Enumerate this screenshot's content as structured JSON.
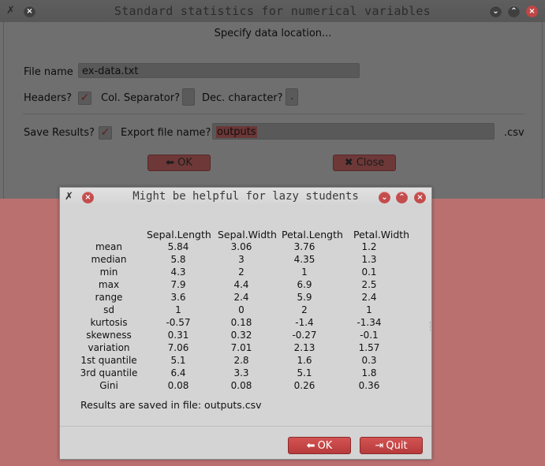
{
  "main_window": {
    "title": "Standard statistics for numerical variables",
    "subtitle": "Specify data location...",
    "file_name_label": "File name",
    "file_name_value": "ex-data.txt",
    "headers_label": "Headers?",
    "col_sep_label": "Col. Separator?",
    "col_sep_value": "",
    "dec_char_label": "Dec. character?",
    "dec_char_value": ".",
    "save_results_label": "Save Results?",
    "export_label": "Export file name?",
    "export_value": "outputs",
    "export_ext": ".csv",
    "ok_label": "OK",
    "close_label": "Close",
    "check_glyph": "✓"
  },
  "dialog": {
    "title": "Might be helpful for lazy students",
    "columns": [
      "Sepal.Length",
      "Sepal.Width",
      "Petal.Length",
      "Petal.Width"
    ],
    "rows": [
      {
        "label": "mean",
        "values": [
          "5.84",
          "3.06",
          "3.76",
          "1.2"
        ]
      },
      {
        "label": "median",
        "values": [
          "5.8",
          "3",
          "4.35",
          "1.3"
        ]
      },
      {
        "label": "min",
        "values": [
          "4.3",
          "2",
          "1",
          "0.1"
        ]
      },
      {
        "label": "max",
        "values": [
          "7.9",
          "4.4",
          "6.9",
          "2.5"
        ]
      },
      {
        "label": "range",
        "values": [
          "3.6",
          "2.4",
          "5.9",
          "2.4"
        ]
      },
      {
        "label": "sd",
        "values": [
          "1",
          "0",
          "2",
          "1"
        ]
      },
      {
        "label": "kurtosis",
        "values": [
          "-0.57",
          "0.18",
          "-1.4",
          "-1.34"
        ]
      },
      {
        "label": "skewness",
        "values": [
          "0.31",
          "0.32",
          "-0.27",
          "-0.1"
        ]
      },
      {
        "label": "variation",
        "values": [
          "7.06",
          "7.01",
          "2.13",
          "1.57"
        ]
      },
      {
        "label": "1st quantile",
        "values": [
          "5.1",
          "2.8",
          "1.6",
          "0.3"
        ]
      },
      {
        "label": "3rd quantile",
        "values": [
          "6.4",
          "3.3",
          "5.1",
          "1.8"
        ]
      },
      {
        "label": "Gini",
        "values": [
          "0.08",
          "0.08",
          "0.26",
          "0.36"
        ]
      }
    ],
    "saved_message": "Results are saved in file: outputs.csv",
    "ok_label": "OK",
    "quit_label": "Quit"
  },
  "colors": {
    "accent_red": "#c44c4c",
    "background_pink": "#bb7070",
    "dialog_bg": "#d4d4d4"
  },
  "icons": [
    "tools-icon",
    "close-circle-icon",
    "minimize-icon",
    "maximize-icon",
    "ok-arrow-icon",
    "close-x-icon",
    "quit-door-icon"
  ]
}
